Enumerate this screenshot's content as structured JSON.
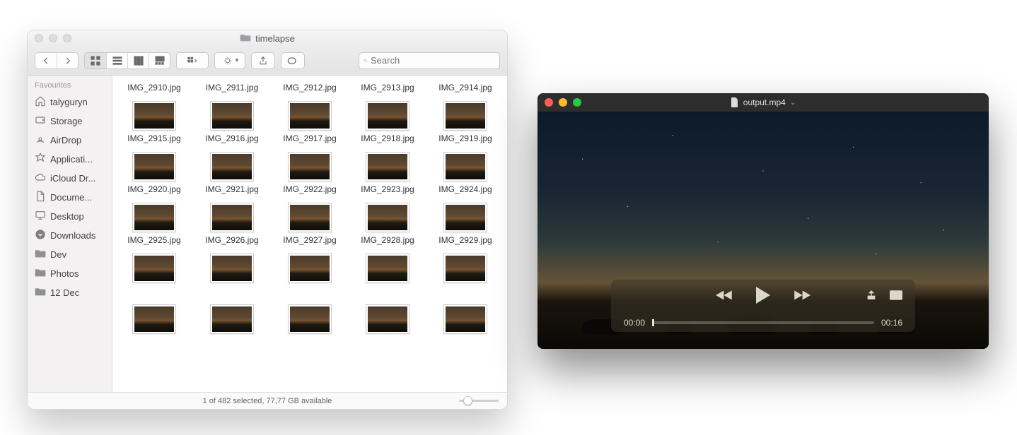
{
  "finder": {
    "window_title": "timelapse",
    "search_placeholder": "Search",
    "sidebar": {
      "header": "Favourites",
      "items": [
        {
          "icon": "home",
          "label": "talyguryn"
        },
        {
          "icon": "disk",
          "label": "Storage"
        },
        {
          "icon": "airdrop",
          "label": "AirDrop"
        },
        {
          "icon": "app",
          "label": "Applicati..."
        },
        {
          "icon": "cloud",
          "label": "iCloud Dr..."
        },
        {
          "icon": "doc",
          "label": "Docume..."
        },
        {
          "icon": "desktop",
          "label": "Desktop"
        },
        {
          "icon": "download",
          "label": "Downloads"
        },
        {
          "icon": "folder",
          "label": "Dev"
        },
        {
          "icon": "folder",
          "label": "Photos"
        },
        {
          "icon": "folder",
          "label": "12 Dec"
        }
      ]
    },
    "files": [
      "IMG_2910.jpg",
      "IMG_2911.jpg",
      "IMG_2912.jpg",
      "IMG_2913.jpg",
      "IMG_2914.jpg",
      "IMG_2915.jpg",
      "IMG_2916.jpg",
      "IMG_2917.jpg",
      "IMG_2918.jpg",
      "IMG_2919.jpg",
      "IMG_2920.jpg",
      "IMG_2921.jpg",
      "IMG_2922.jpg",
      "IMG_2923.jpg",
      "IMG_2924.jpg",
      "IMG_2925.jpg",
      "IMG_2926.jpg",
      "IMG_2927.jpg",
      "IMG_2928.jpg",
      "IMG_2929.jpg",
      "",
      "",
      "",
      "",
      ""
    ],
    "status": "1 of 482 selected, 77,77 GB available"
  },
  "quicktime": {
    "title": "output.mp4",
    "time_current": "00:00",
    "time_total": "00:16"
  }
}
